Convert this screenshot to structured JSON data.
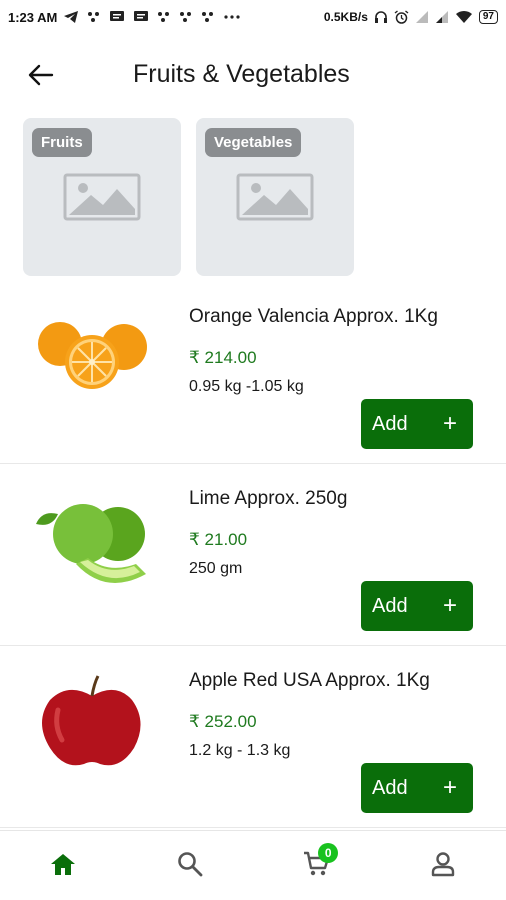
{
  "status_bar": {
    "time": "1:23 AM",
    "speed": "0.5KB/s",
    "battery": "97",
    "icons": [
      "telegram-icon",
      "dots-icon",
      "message-icon",
      "message-icon",
      "dots-icon",
      "dots-icon",
      "dots-icon",
      "more-icon",
      "headphones-icon",
      "alarm-icon",
      "signal-icon",
      "signal-icon",
      "wifi-icon"
    ]
  },
  "header": {
    "title": "Fruits & Vegetables",
    "back_icon": "arrow-left-icon"
  },
  "categories": [
    {
      "label": "Fruits",
      "icon": "image-placeholder-icon"
    },
    {
      "label": "Vegetables",
      "icon": "image-placeholder-icon"
    }
  ],
  "products": [
    {
      "name": "Orange Valencia Approx. 1Kg",
      "price": "₹ 214.00",
      "quantity": "0.95 kg -1.05 kg",
      "add_label": "Add",
      "add_icon": "+",
      "image": "orange-image"
    },
    {
      "name": "Lime Approx. 250g",
      "price": "₹ 21.00",
      "quantity": "250 gm",
      "add_label": "Add",
      "add_icon": "+",
      "image": "lime-image"
    },
    {
      "name": "Apple Red USA Approx. 1Kg",
      "price": "₹ 252.00",
      "quantity": "1.2 kg - 1.3 kg",
      "add_label": "Add",
      "add_icon": "+",
      "image": "apple-image"
    }
  ],
  "bottom_nav": {
    "items": [
      "home-icon",
      "search-icon",
      "cart-icon",
      "profile-icon"
    ],
    "cart_count": "0",
    "active_color": "#0a6e0a"
  },
  "colors": {
    "accent": "#0a6e0a",
    "price": "#1f7a1f",
    "badge": "#19c21f",
    "category_bg": "#e6e9ec",
    "category_label_bg": "#8a8d90"
  }
}
